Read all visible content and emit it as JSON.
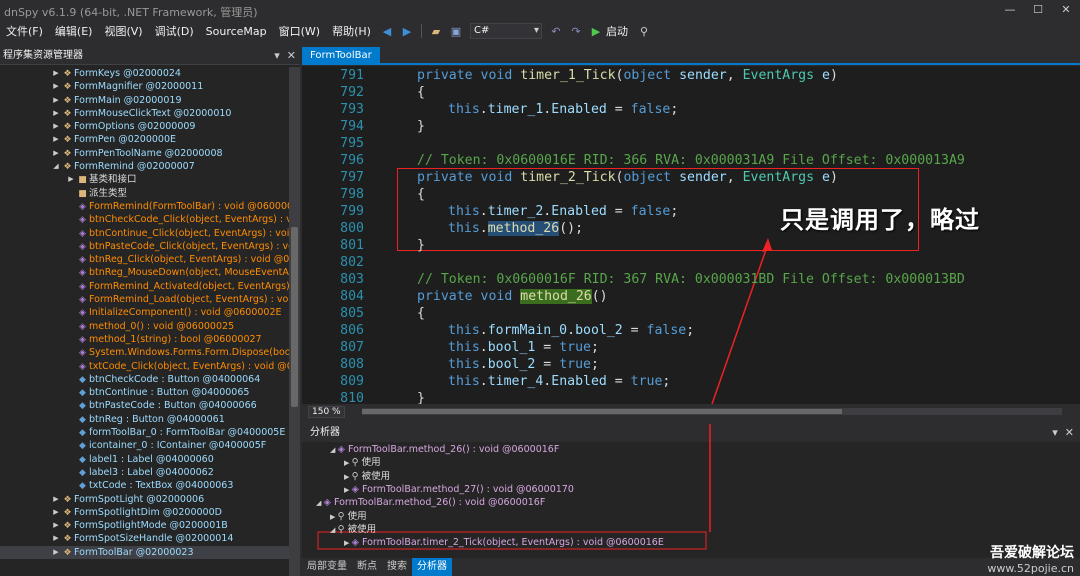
{
  "window": {
    "title": "dnSpy v6.1.9 (64-bit, .NET Framework, 管理员)",
    "min": "—",
    "max": "☐",
    "close": "✕"
  },
  "menu": [
    "文件(F)",
    "编辑(E)",
    "视图(V)",
    "调试(D)",
    "SourceMap",
    "窗口(W)",
    "帮助(H)"
  ],
  "toolbar": {
    "language": "C#",
    "start_label": "启动"
  },
  "left_panel": {
    "title": "程序集资源管理器",
    "pin": "▾",
    "close": "✕"
  },
  "tree": [
    {
      "text": "FormKeys @02000024",
      "indent": 2,
      "arrow": "▶",
      "icon": "class",
      "color": "#9cdcfe"
    },
    {
      "text": "FormMagnifier @02000011",
      "indent": 2,
      "arrow": "▶",
      "icon": "class",
      "color": "#9cdcfe"
    },
    {
      "text": "FormMain @02000019",
      "indent": 2,
      "arrow": "▶",
      "icon": "class",
      "color": "#9cdcfe"
    },
    {
      "text": "FormMouseClickText @02000010",
      "indent": 2,
      "arrow": "▶",
      "icon": "class",
      "color": "#9cdcfe"
    },
    {
      "text": "FormOptions @02000009",
      "indent": 2,
      "arrow": "▶",
      "icon": "class",
      "color": "#9cdcfe"
    },
    {
      "text": "FormPen @0200000E",
      "indent": 2,
      "arrow": "▶",
      "icon": "class",
      "color": "#9cdcfe"
    },
    {
      "text": "FormPenToolName @02000008",
      "indent": 2,
      "arrow": "▶",
      "icon": "class",
      "color": "#9cdcfe"
    },
    {
      "text": "FormRemind @02000007",
      "indent": 2,
      "arrow": "◢",
      "icon": "class",
      "color": "#9cdcfe"
    },
    {
      "text": "基类和接口",
      "indent": 3,
      "arrow": "▶",
      "icon": "folder",
      "color": "#dcdcdc"
    },
    {
      "text": "派生类型",
      "indent": 3,
      "arrow": "",
      "icon": "folder",
      "color": "#dcdcdc"
    },
    {
      "text": "FormRemind(FormToolBar) : void @0600002",
      "indent": 3,
      "arrow": "",
      "icon": "method",
      "color": "#ff8c00"
    },
    {
      "text": "btnCheckCode_Click(object, EventArgs) : void",
      "indent": 3,
      "arrow": "",
      "icon": "method",
      "color": "#ff8c00"
    },
    {
      "text": "btnContinue_Click(object, EventArgs) : void @",
      "indent": 3,
      "arrow": "",
      "icon": "method",
      "color": "#ff8c00"
    },
    {
      "text": "btnPasteCode_Click(object, EventArgs) : voi",
      "indent": 3,
      "arrow": "",
      "icon": "method",
      "color": "#ff8c00"
    },
    {
      "text": "btnReg_Click(object, EventArgs) : void @060",
      "indent": 3,
      "arrow": "",
      "icon": "method",
      "color": "#ff8c00"
    },
    {
      "text": "btnReg_MouseDown(object, MouseEventArg",
      "indent": 3,
      "arrow": "",
      "icon": "method",
      "color": "#ff8c00"
    },
    {
      "text": "FormRemind_Activated(object, EventArgs) : v",
      "indent": 3,
      "arrow": "",
      "icon": "method",
      "color": "#ff8c00"
    },
    {
      "text": "FormRemind_Load(object, EventArgs) : void",
      "indent": 3,
      "arrow": "",
      "icon": "method",
      "color": "#ff8c00"
    },
    {
      "text": "InitializeComponent() : void @0600002E",
      "indent": 3,
      "arrow": "",
      "icon": "method",
      "color": "#ff8c00"
    },
    {
      "text": "method_0() : void @06000025",
      "indent": 3,
      "arrow": "",
      "icon": "method",
      "color": "#ff8c00"
    },
    {
      "text": "method_1(string) : bool @06000027",
      "indent": 3,
      "arrow": "",
      "icon": "method",
      "color": "#ff8c00"
    },
    {
      "text": "System.Windows.Forms.Form.Dispose(bool)",
      "indent": 3,
      "arrow": "",
      "icon": "method",
      "color": "#ff8c00"
    },
    {
      "text": "txtCode_Click(object, EventArgs) : void @06",
      "indent": 3,
      "arrow": "",
      "icon": "method",
      "color": "#ff8c00"
    },
    {
      "text": "btnCheckCode : Button @04000064",
      "indent": 3,
      "arrow": "",
      "icon": "field",
      "color": "#9cdcfe"
    },
    {
      "text": "btnContinue : Button @04000065",
      "indent": 3,
      "arrow": "",
      "icon": "field",
      "color": "#9cdcfe"
    },
    {
      "text": "btnPasteCode : Button @04000066",
      "indent": 3,
      "arrow": "",
      "icon": "field",
      "color": "#9cdcfe"
    },
    {
      "text": "btnReg : Button @04000061",
      "indent": 3,
      "arrow": "",
      "icon": "field",
      "color": "#9cdcfe"
    },
    {
      "text": "formToolBar_0 : FormToolBar @0400005E",
      "indent": 3,
      "arrow": "",
      "icon": "field",
      "color": "#9cdcfe"
    },
    {
      "text": "icontainer_0 : IContainer @0400005F",
      "indent": 3,
      "arrow": "",
      "icon": "field",
      "color": "#9cdcfe"
    },
    {
      "text": "label1 : Label @04000060",
      "indent": 3,
      "arrow": "",
      "icon": "field",
      "color": "#9cdcfe"
    },
    {
      "text": "label3 : Label @04000062",
      "indent": 3,
      "arrow": "",
      "icon": "field",
      "color": "#9cdcfe"
    },
    {
      "text": "txtCode : TextBox @04000063",
      "indent": 3,
      "arrow": "",
      "icon": "field",
      "color": "#9cdcfe"
    },
    {
      "text": "FormSpotLight @02000006",
      "indent": 2,
      "arrow": "▶",
      "icon": "class",
      "color": "#9cdcfe"
    },
    {
      "text": "FormSpotlightDim @0200000D",
      "indent": 2,
      "arrow": "▶",
      "icon": "class",
      "color": "#9cdcfe"
    },
    {
      "text": "FormSpotlightMode @0200001B",
      "indent": 2,
      "arrow": "▶",
      "icon": "class",
      "color": "#9cdcfe"
    },
    {
      "text": "FormSpotSizeHandle @02000014",
      "indent": 2,
      "arrow": "▶",
      "icon": "class",
      "color": "#9cdcfe"
    },
    {
      "text": "FormToolBar @02000023",
      "indent": 2,
      "arrow": "▶",
      "icon": "class",
      "color": "#9cdcfe",
      "selected": true
    }
  ],
  "editor": {
    "tab": "FormToolBar",
    "lines": [
      {
        "n": "791",
        "html": "<span class='kw'>private</span> <span class='kw'>void</span> <span class='fn'>timer_1_Tick</span>(<span class='kw'>object</span> <span class='pa'>sender</span>, <span class='ty'>EventArgs</span> <span class='pa'>e</span>)",
        "ind": 0
      },
      {
        "n": "792",
        "html": "{",
        "ind": 0
      },
      {
        "n": "793",
        "html": "<span class='kw'>this</span>.<span class='pa'>timer_1</span>.<span class='pa'>Enabled</span> = <span class='kw'>false</span>;",
        "ind": 1
      },
      {
        "n": "794",
        "html": "}",
        "ind": 0
      },
      {
        "n": "795",
        "html": "",
        "ind": 0
      },
      {
        "n": "796",
        "html": "<span class='cm'>// Token: 0x0600016E RID: 366 RVA: 0x000031A9 File Offset: 0x000013A9</span>",
        "ind": 0
      },
      {
        "n": "797",
        "html": "<span class='kw'>private</span> <span class='kw'>void</span> <span class='fn'>timer_2_Tick</span>(<span class='kw'>object</span> <span class='pa'>sender</span>, <span class='ty'>EventArgs</span> <span class='pa'>e</span>)",
        "ind": 0
      },
      {
        "n": "798",
        "html": "{",
        "ind": 0
      },
      {
        "n": "799",
        "html": "<span class='kw'>this</span>.<span class='pa'>timer_2</span>.<span class='pa'>Enabled</span> = <span class='kw'>false</span>;",
        "ind": 1
      },
      {
        "n": "800",
        "html": "<span class='kw'>this</span>.<span class='fn hl'>method_26</span>();",
        "ind": 1
      },
      {
        "n": "801",
        "html": "}",
        "ind": 0
      },
      {
        "n": "802",
        "html": "",
        "ind": 0
      },
      {
        "n": "803",
        "html": "<span class='cm'>// Token: 0x0600016F RID: 367 RVA: 0x000031BD File Offset: 0x000013BD</span>",
        "ind": 0
      },
      {
        "n": "804",
        "html": "<span class='kw'>private</span> <span class='kw'>void</span> <span class='fn hl2'>method_26</span>()",
        "ind": 0
      },
      {
        "n": "805",
        "html": "{",
        "ind": 0
      },
      {
        "n": "806",
        "html": "<span class='kw'>this</span>.<span class='pa'>formMain_0</span>.<span class='pa'>bool_2</span> = <span class='kw'>false</span>;",
        "ind": 1
      },
      {
        "n": "807",
        "html": "<span class='kw'>this</span>.<span class='pa'>bool_1</span> = <span class='kw'>true</span>;",
        "ind": 1
      },
      {
        "n": "808",
        "html": "<span class='kw'>this</span>.<span class='pa'>bool_2</span> = <span class='kw'>true</span>;",
        "ind": 1
      },
      {
        "n": "809",
        "html": "<span class='kw'>this</span>.<span class='pa'>timer_4</span>.<span class='pa'>Enabled</span> = <span class='kw'>true</span>;",
        "ind": 1
      },
      {
        "n": "810",
        "html": "}",
        "ind": 0
      }
    ],
    "annotation": "只是调用了，略过",
    "zoom": "150 %"
  },
  "analyzer": {
    "title": "分析器",
    "rows": [
      {
        "text": "FormToolBar.method_26() : void @0600016F",
        "indent": 1,
        "arrow": "◢",
        "icon": "method"
      },
      {
        "text": "使用",
        "indent": 2,
        "arrow": "▶",
        "icon": "search"
      },
      {
        "text": "被使用",
        "indent": 2,
        "arrow": "▶",
        "icon": "search"
      },
      {
        "text": "FormToolBar.method_27() : void @06000170",
        "indent": 2,
        "arrow": "▶",
        "icon": "method"
      },
      {
        "text": "FormToolBar.method_26() : void @0600016F",
        "indent": 0,
        "arrow": "◢",
        "icon": "method"
      },
      {
        "text": "使用",
        "indent": 1,
        "arrow": "▶",
        "icon": "search"
      },
      {
        "text": "被使用",
        "indent": 1,
        "arrow": "◢",
        "icon": "search"
      },
      {
        "text": "FormToolBar.timer_2_Tick(object, EventArgs) : void @0600016E",
        "indent": 2,
        "arrow": "▶",
        "icon": "method",
        "boxed": true
      }
    ]
  },
  "bottom_tabs": [
    "局部变量",
    "断点",
    "搜索",
    "分析器"
  ],
  "watermark": {
    "line1": "吾爱破解论坛",
    "line2": "www.52pojie.cn"
  }
}
